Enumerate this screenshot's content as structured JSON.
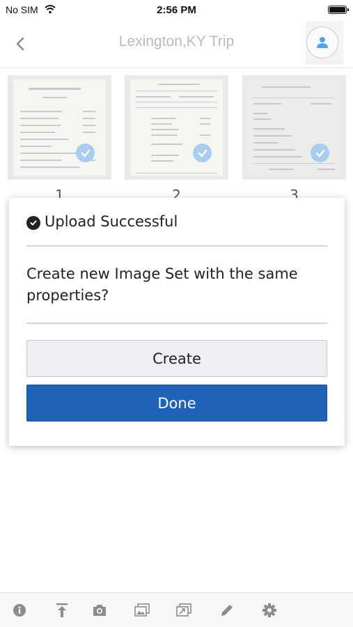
{
  "status_bar": {
    "carrier": "No SIM",
    "time": "2:56 PM",
    "battery_level": 1.0
  },
  "nav": {
    "title": "Lexington,KY Trip",
    "back_icon": "chevron-left-icon",
    "profile_icon": "user-icon"
  },
  "thumbnails": [
    {
      "number": "1",
      "selected": true
    },
    {
      "number": "2",
      "selected": true
    },
    {
      "number": "3",
      "selected": true
    }
  ],
  "modal": {
    "heading": "Upload Successful",
    "message": "Create new Image Set with the same properties?",
    "create_label": "Create",
    "done_label": "Done"
  },
  "toolbar": {
    "icons": [
      "info-icon",
      "upload-icon",
      "camera-icon",
      "gallery-icon",
      "gallery-export-icon",
      "pencil-icon",
      "gear-icon"
    ]
  },
  "colors": {
    "primary": "#1f63b8",
    "check_badge": "#a9cdee",
    "title_gray": "#b9b9b9"
  }
}
